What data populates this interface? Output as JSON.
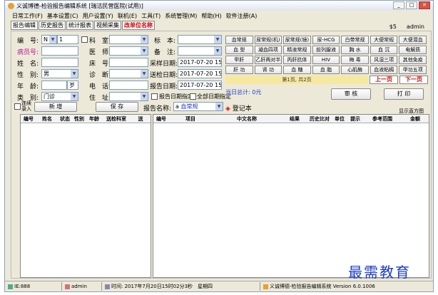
{
  "window": {
    "title": "义诚博德-检验报告编辑系统 [瑞洁民营医院(试用)]"
  },
  "menu": [
    "日常工作(F)",
    "基本设置(C)",
    "用户设置(Y)",
    "联机(E)",
    "工具(T)",
    "系统管理(M)",
    "帮助(H)",
    "软件注册(A)"
  ],
  "tabs": [
    "报告编辑",
    "历史报告",
    "统计报表",
    "视频采集",
    "改单位名称"
  ],
  "user": {
    "icon_label": "$5",
    "name": "admin"
  },
  "form": {
    "labels": {
      "bianhao": "编　号:",
      "keshi": "科　室:",
      "biaoben": "标　本:",
      "binglihao": "病员号:",
      "yishi": "医　师:",
      "beizhu": "备　注:",
      "xingming": "姓　名:",
      "chuanghao": "床　号:",
      "caiyang": "采样日期:",
      "xingbie": "性　别:",
      "zhenduan": "诊　断:",
      "songjian": "送检日期:",
      "nianling": "年　龄:",
      "dianhua": "电　话:",
      "baogao": "报告日期:",
      "leibie": "类　别:",
      "zhuzhi": "住　址:"
    },
    "bianhao_prefix": "N",
    "bianhao_value": "1",
    "xingbie_value": "男",
    "age_unit": "岁",
    "leibie_value": "门诊",
    "caiyang_value": "2017-07-20 15:01",
    "songjian_value": "2017-07-20 15:01",
    "baogao_value": "2017-07-20 15:01",
    "chk_report_date": "报告日期指定",
    "chk_all_date": "全部日期指定",
    "chk_continuous": "连续录入",
    "add_button": "新 增",
    "save_button": "保 存",
    "report_name_label": "报告名称:",
    "report_name_prefix": "a",
    "report_name_value": "血常规",
    "register_button": "登记本",
    "day_total": "当日总计: 0元",
    "review_button": "审 核",
    "print_button": "打 印",
    "show_chart": "显示直方图"
  },
  "quick_buttons": [
    "血常规",
    "尿常规(机)",
    "尿常规(镜)",
    "尿-HCG",
    "白带常规",
    "大便常规",
    "大便潜血",
    "血 型",
    "凝血四项",
    "精液常规",
    "前列腺液",
    "胸 水",
    "血 沉",
    "电解质",
    "甲肝",
    "乙肝两对半",
    "丙肝抗体",
    "HIV",
    "梅 毒",
    "风湿三项",
    "其他免疫",
    "肝 功",
    "肾 功",
    "血 糖",
    "血 脂",
    "心肌酶",
    "血液粘稠",
    "甲功五项"
  ],
  "pager": {
    "info": "第1页, 共2页",
    "prev": "上一页",
    "next": "下一页"
  },
  "left_table": {
    "headers": [
      "编号",
      "姓名",
      "状态",
      "性别",
      "年龄",
      "送检科室",
      "送"
    ]
  },
  "right_table": {
    "headers": [
      "编号",
      "项目",
      "中文名称",
      "结果",
      "历史比对",
      "单位",
      "提示",
      "参考范围",
      "金额"
    ]
  },
  "statusbar": {
    "ip": "IE:888",
    "user": "admin",
    "time": "时间: 2017年7月20日15时02分3秒　星期四",
    "version": "义诚博德-检验报告编辑系统 Version 6.0.1006"
  },
  "watermark": "最需教育"
}
